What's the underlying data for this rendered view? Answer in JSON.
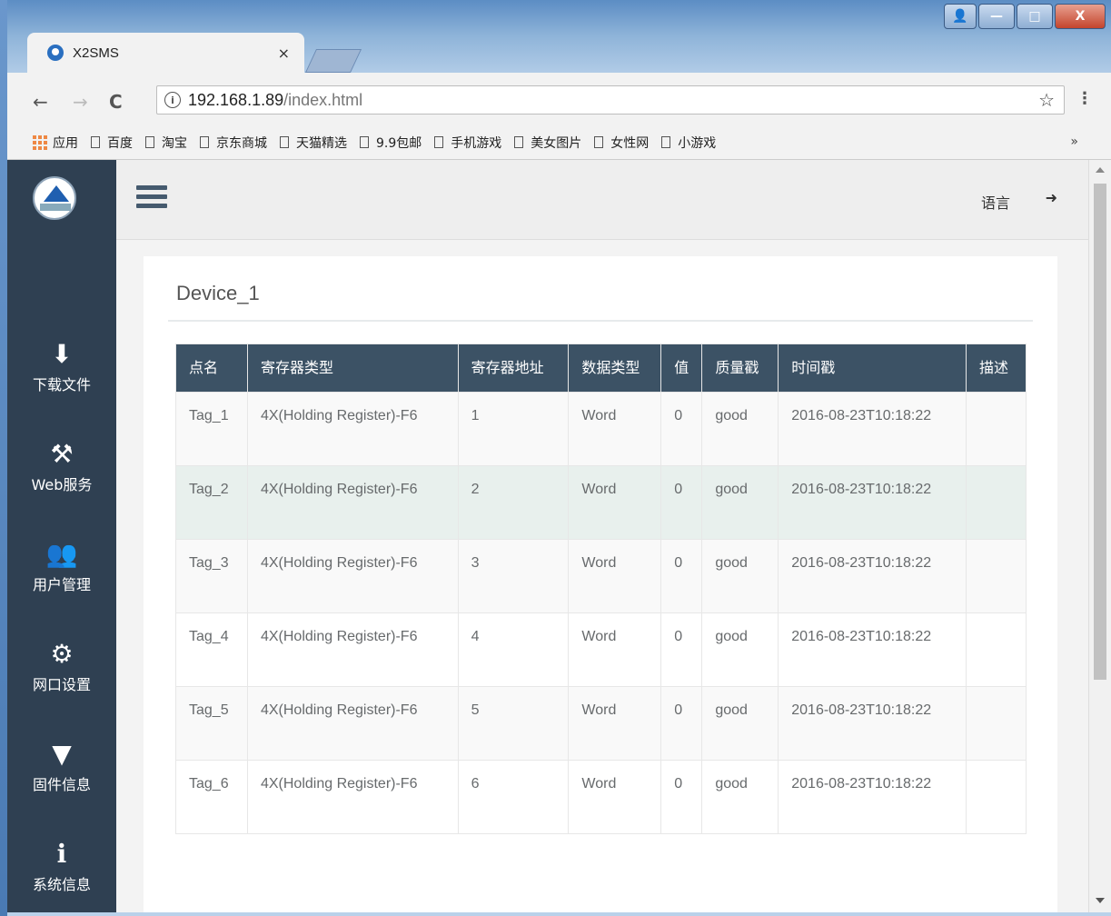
{
  "browser": {
    "tab_title": "X2SMS",
    "tab_close": "×",
    "url_host": "192.168.1.89",
    "url_path": "/index.html",
    "info_glyph": "i",
    "back_glyph": "←",
    "forward_glyph": "→",
    "reload_glyph": "C",
    "star_glyph": "☆",
    "menu_glyph": "⋮",
    "more_glyph": "»",
    "window_controls": {
      "min": "—",
      "max": "□",
      "close": "X",
      "user": "👤"
    }
  },
  "bookmarks": {
    "apps": "应用",
    "items": [
      "百度",
      "淘宝",
      "京东商城",
      "天猫精选",
      "9.9包邮",
      "手机游戏",
      "美女图片",
      "女性网",
      "小游戏"
    ]
  },
  "sidebar": {
    "items": [
      {
        "label": "下载文件",
        "icon": "download-icon",
        "glyph": "⬇"
      },
      {
        "label": "Web服务",
        "icon": "gavel-icon",
        "glyph": "⚒"
      },
      {
        "label": "用户管理",
        "icon": "users-icon",
        "glyph": "👥"
      },
      {
        "label": "网口设置",
        "icon": "gear-icon",
        "glyph": "⚙"
      },
      {
        "label": "固件信息",
        "icon": "filter-icon",
        "glyph": "▼"
      },
      {
        "label": "系统信息",
        "icon": "info-icon",
        "glyph": "ℹ"
      }
    ]
  },
  "topbar": {
    "language": "语言",
    "logout_glyph": "➜"
  },
  "device": {
    "title": "Device_1",
    "columns": [
      "点名",
      "寄存器类型",
      "寄存器地址",
      "数据类型",
      "值",
      "质量戳",
      "时间戳",
      "描述"
    ],
    "rows": [
      {
        "name": "Tag_1",
        "reg_type": "4X(Holding Register)-F6",
        "address": "1",
        "data_type": "Word",
        "value": "0",
        "quality": "good",
        "timestamp": "2016-08-23T10:18:22",
        "desc": ""
      },
      {
        "name": "Tag_2",
        "reg_type": "4X(Holding Register)-F6",
        "address": "2",
        "data_type": "Word",
        "value": "0",
        "quality": "good",
        "timestamp": "2016-08-23T10:18:22",
        "desc": ""
      },
      {
        "name": "Tag_3",
        "reg_type": "4X(Holding Register)-F6",
        "address": "3",
        "data_type": "Word",
        "value": "0",
        "quality": "good",
        "timestamp": "2016-08-23T10:18:22",
        "desc": ""
      },
      {
        "name": "Tag_4",
        "reg_type": "4X(Holding Register)-F6",
        "address": "4",
        "data_type": "Word",
        "value": "0",
        "quality": "good",
        "timestamp": "2016-08-23T10:18:22",
        "desc": ""
      },
      {
        "name": "Tag_5",
        "reg_type": "4X(Holding Register)-F6",
        "address": "5",
        "data_type": "Word",
        "value": "0",
        "quality": "good",
        "timestamp": "2016-08-23T10:18:22",
        "desc": ""
      },
      {
        "name": "Tag_6",
        "reg_type": "4X(Holding Register)-F6",
        "address": "6",
        "data_type": "Word",
        "value": "0",
        "quality": "good",
        "timestamp": "2016-08-23T10:18:22",
        "desc": ""
      }
    ]
  },
  "colors": {
    "sidebar_bg": "#2f4052",
    "table_header_bg": "#3c5265",
    "row_hover": "#e8f0ed"
  }
}
